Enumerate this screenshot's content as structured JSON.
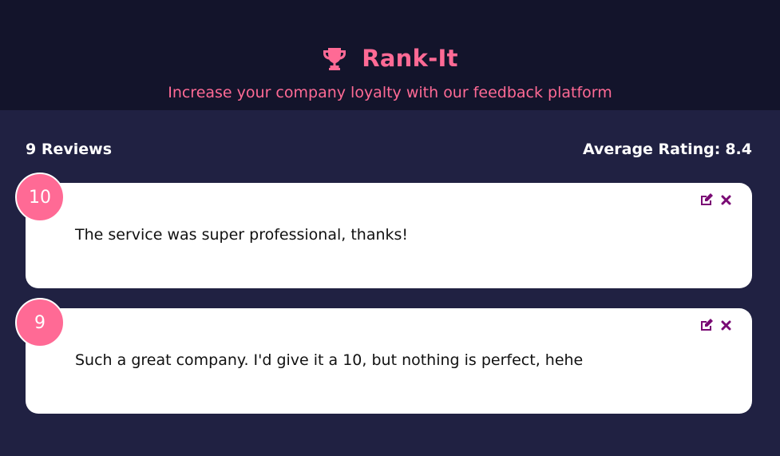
{
  "header": {
    "icon": "trophy-icon",
    "title": "Rank-It",
    "subtitle": "Increase your company loyalty with our feedback platform",
    "accent_color": "#ff6a95"
  },
  "stats": {
    "reviews_count": "9 Reviews",
    "average_label": "Average Rating:",
    "average_value": "8.4"
  },
  "reviews": [
    {
      "rating": "10",
      "text": "The service was super professional, thanks!"
    },
    {
      "rating": "9",
      "text": "Such a great company. I'd give it a 10, but nothing is perfect, hehe"
    }
  ],
  "icons": {
    "edit": "edit-icon",
    "delete": "close-icon",
    "edit_color": "#7a0a74"
  }
}
